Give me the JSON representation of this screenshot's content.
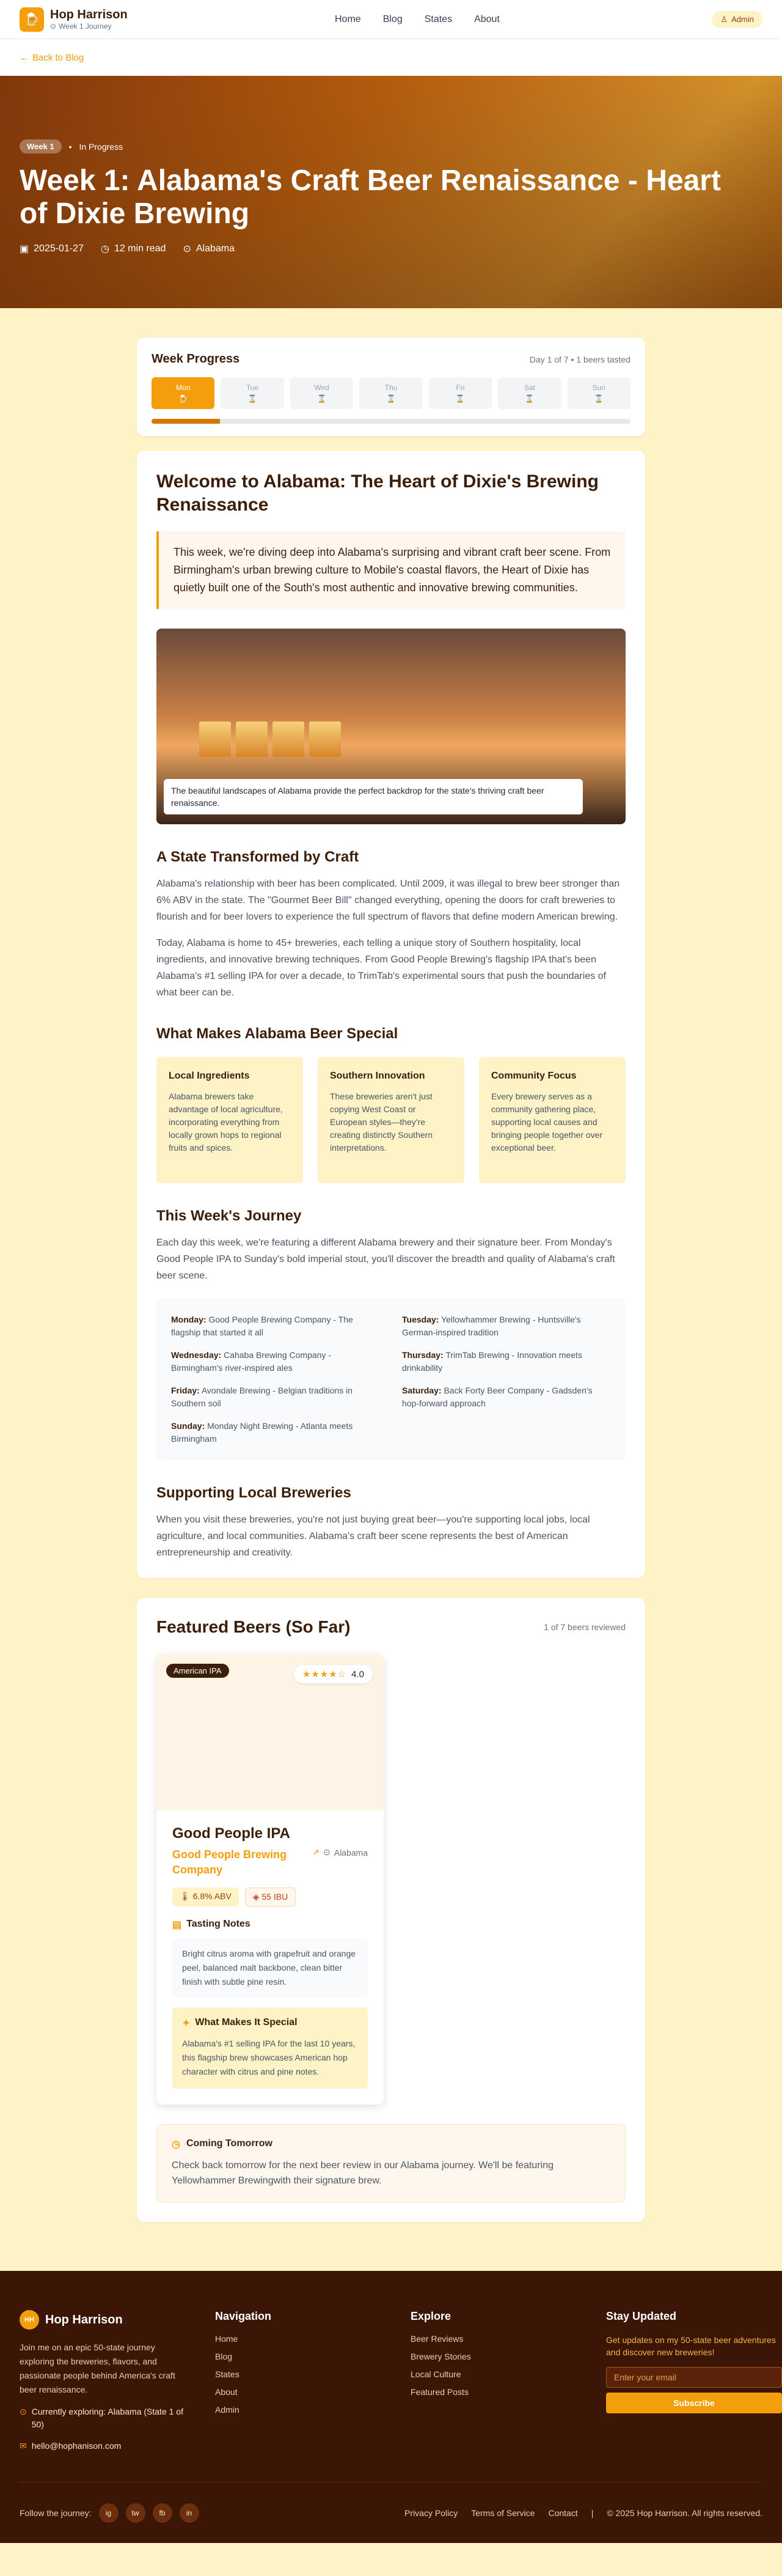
{
  "header": {
    "brand_title": "Hop Harrison",
    "brand_sub": "Week 1 Journey",
    "nav": [
      "Home",
      "Blog",
      "States",
      "About"
    ],
    "admin": "Admin",
    "back": "Back to Blog"
  },
  "hero": {
    "week_chip": "Week 1",
    "status": "In Progress",
    "title": "Week 1: Alabama's Craft Beer Renaissance - Heart of Dixie Brewing",
    "date": "2025-01-27",
    "read_time": "12 min read",
    "state": "Alabama"
  },
  "progress": {
    "title": "Week Progress",
    "count": "Day 1 of 7 • 1 beers tasted",
    "days": [
      "Mon",
      "Tue",
      "Wed",
      "Thu",
      "Fri",
      "Sat",
      "Sun"
    ],
    "completed_fraction": 0.143
  },
  "article": {
    "title": "Welcome to Alabama: The Heart of Dixie's Brewing Renaissance",
    "intro": "This week, we're diving deep into Alabama's surprising and vibrant craft beer scene. From Birmingham's urban brewing culture to Mobile's coastal flavors, the Heart of Dixie has quietly built one of the South's most authentic and innovative brewing communities.",
    "caption": "The beautiful landscapes of Alabama provide the perfect backdrop for the state's thriving craft beer renaissance.",
    "h_transformed": "A State Transformed by Craft",
    "p1": "Alabama's relationship with beer has been complicated. Until 2009, it was illegal to brew beer stronger than 6% ABV in the state. The \"Gourmet Beer Bill\" changed everything, opening the doors for craft breweries to flourish and for beer lovers to experience the full spectrum of flavors that define modern American brewing.",
    "p2": "Today, Alabama is home to 45+ breweries, each telling a unique story of Southern hospitality, local ingredients, and innovative brewing techniques. From Good People Brewing's flagship IPA that's been Alabama's #1 selling IPA for over a decade, to TrimTab's experimental sours that push the boundaries of what beer can be.",
    "h_special": "What Makes Alabama Beer Special",
    "features": [
      {
        "title": "Local Ingredients",
        "text": "Alabama brewers take advantage of local agriculture, incorporating everything from locally grown hops to regional fruits and spices."
      },
      {
        "title": "Southern Innovation",
        "text": "These breweries aren't just copying West Coast or European styles—they're creating distinctly Southern interpretations."
      },
      {
        "title": "Community Focus",
        "text": "Every brewery serves as a community gathering place, supporting local causes and bringing people together over exceptional beer."
      }
    ],
    "h_journey": "This Week's Journey",
    "p_journey": "Each day this week, we're featuring a different Alabama brewery and their signature beer. From Monday's Good People IPA to Sunday's bold imperial stout, you'll discover the breadth and quality of Alabama's craft beer scene.",
    "journey": [
      {
        "day": "Monday:",
        "text": "Good People Brewing Company - The flagship that started it all"
      },
      {
        "day": "Tuesday:",
        "text": "Yellowhammer Brewing - Huntsville's German-inspired tradition"
      },
      {
        "day": "Wednesday:",
        "text": "Cahaba Brewing Company - Birmingham's river-inspired ales"
      },
      {
        "day": "Thursday:",
        "text": "TrimTab Brewing - Innovation meets drinkability"
      },
      {
        "day": "Friday:",
        "text": "Avondale Brewing - Belgian traditions in Southern soil"
      },
      {
        "day": "Saturday:",
        "text": "Back Forty Beer Company - Gadsden's hop-forward approach"
      },
      {
        "day": "Sunday:",
        "text": "Monday Night Brewing - Atlanta meets Birmingham"
      }
    ],
    "h_support": "Supporting Local Breweries",
    "p_support": "When you visit these breweries, you're not just buying great beer—you're supporting local jobs, local agriculture, and local communities. Alabama's craft beer scene represents the best of American entrepreneurship and creativity."
  },
  "featured": {
    "title": "Featured Beers (So Far)",
    "count": "1 of 7 beers reviewed",
    "beer": {
      "style": "American IPA",
      "stars": "★★★★☆",
      "rating": "4.0",
      "name": "Good People IPA",
      "brewery": "Good People Brewing Company",
      "state": "Alabama",
      "abv": "6.8% ABV",
      "ibu": "55 IBU",
      "tasting_title": "Tasting Notes",
      "tasting": "Bright citrus aroma with grapefruit and orange peel, balanced malt backbone, clean bitter finish with subtle pine resin.",
      "special_title": "What Makes It Special",
      "special": "Alabama's #1 selling IPA for the last 10 years, this flagship brew showcases American hop character with citrus and pine notes."
    },
    "tomorrow_title": "Coming Tomorrow",
    "tomorrow": "Check back tomorrow for the next beer review in our Alabama journey. We'll be featuring Yellowhammer Brewingwith their signature brew."
  },
  "footer": {
    "brand": "Hop Harrison",
    "logo": "HH",
    "desc": "Join me on an epic 50-state journey exploring the breweries, flavors, and passionate people behind America's craft beer renaissance.",
    "exploring": "Currently exploring: Alabama (State 1 of 50)",
    "email_addr": "hello@hophanison.com",
    "nav_title": "Navigation",
    "nav": [
      "Home",
      "Blog",
      "States",
      "About",
      "Admin"
    ],
    "explore_title": "Explore",
    "explore": [
      "Beer Reviews",
      "Brewery Stories",
      "Local Culture",
      "Featured Posts"
    ],
    "stay_title": "Stay Updated",
    "stay_text": "Get updates on my 50-state beer adventures and discover new breweries!",
    "email_placeholder": "Enter your email",
    "subscribe": "Subscribe",
    "follow": "Follow the journey:",
    "social": [
      "ig",
      "tw",
      "fb",
      "in"
    ],
    "legal": [
      "Privacy Policy",
      "Terms of Service",
      "Contact"
    ],
    "copyright": "© 2025 Hop Harrison. All rights reserved."
  }
}
